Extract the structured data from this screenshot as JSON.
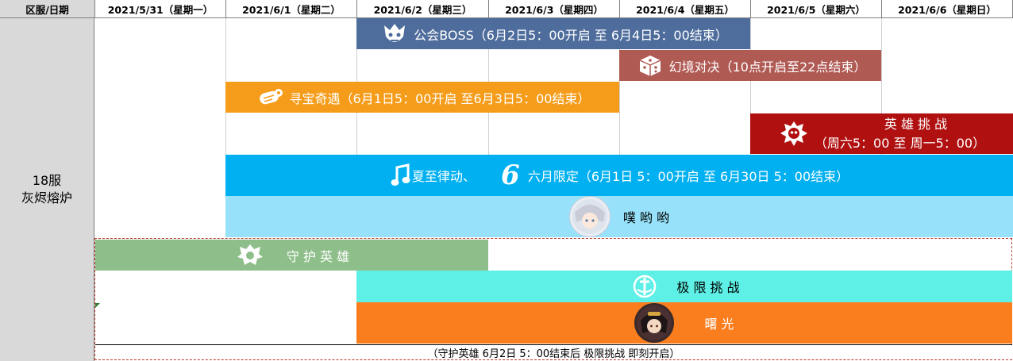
{
  "header": {
    "corner": "区服/日期",
    "days": [
      "2021/5/31（星期一）",
      "2021/6/1（星期二）",
      "2021/6/2（星期三）",
      "2021/6/3（星期四）",
      "2021/6/4（星期五）",
      "2021/6/5（星期六）",
      "2021/6/6（星期日）"
    ]
  },
  "server": {
    "line1": "18服",
    "line2": "灰烬熔炉"
  },
  "events": {
    "guild_boss": {
      "label": "公会BOSS（6月2日5：00开启  至 6月4日5：00结束）",
      "color": "#4e6d9c",
      "icon": "demon-mask-icon"
    },
    "duel": {
      "label": "幻境对决（10点开启至22点结束）",
      "color": "#b05a54",
      "icon": "dice-icon"
    },
    "treasure": {
      "label": "寻宝奇遇（6月1日5：00开启 至6月3日5：00结束）",
      "color": "#f59c1a",
      "icon": "scroll-icon"
    },
    "hero_challenge": {
      "title": "英 雄 挑 战",
      "subtitle": "（周六5：00 至 周一5：00）",
      "color": "#b01010",
      "icon": "skull-crest-icon"
    },
    "summer": {
      "part1": "夏至律动、",
      "badge": "6",
      "part2": "六月限定（6月1日 5：00开启 至 6月30日 5：00结束）",
      "color": "#00b0f0",
      "icon": "music-note-icon"
    },
    "pupu": {
      "label": "噗 哟 哟",
      "color": "#97e2fa"
    },
    "guard_hero": {
      "label": "守 护 英 雄",
      "color": "#8ebf8a",
      "icon": "shield-crest-icon"
    },
    "extreme": {
      "label": "极  限  挑  战",
      "color": "#5ef0e6",
      "icon": "crossed-swords-icon"
    },
    "dawn": {
      "label": "曙  光",
      "color": "#fa7d1e"
    }
  },
  "footnote": "（守护英雄 6月2日 5：00结束后 极限挑战 即刻开启）"
}
